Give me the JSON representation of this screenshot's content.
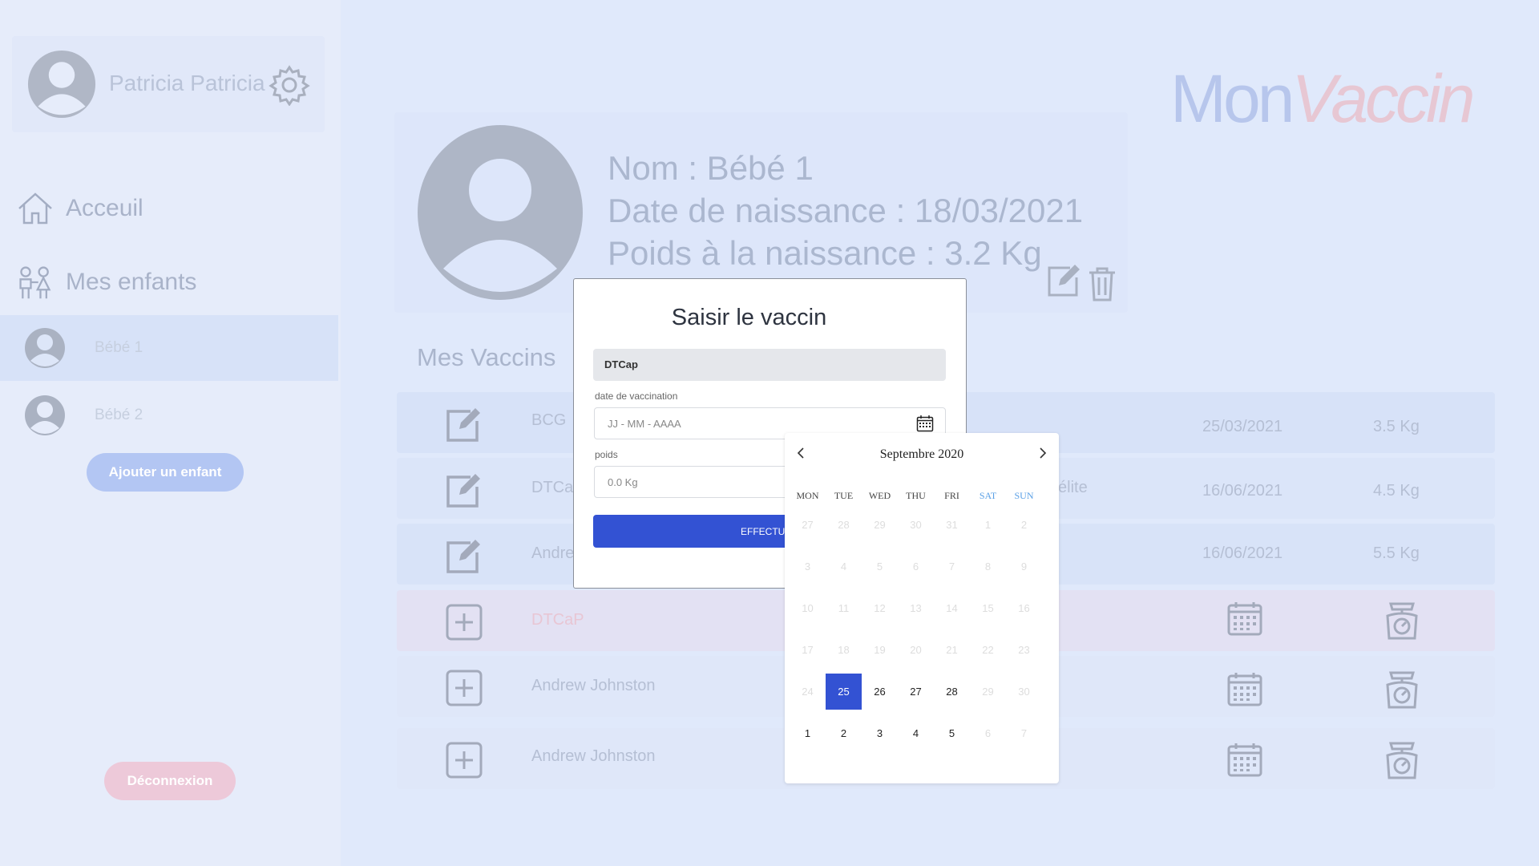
{
  "user": {
    "name": "Patricia Patricia"
  },
  "nav": {
    "home": "Acceuil",
    "children": "Mes enfants"
  },
  "children": [
    {
      "name": "Bébé 1"
    },
    {
      "name": "Bébé 2"
    }
  ],
  "buttons": {
    "add_child": "Ajouter un enfant",
    "logout": "Déconnexion"
  },
  "logo": {
    "part1": "Mon",
    "part2": "Vaccin"
  },
  "profile": {
    "name_line": "Nom : Bébé 1",
    "birth_line": "Date de naissance : 18/03/2021",
    "weight_line": "Poids à la naissance : 3.2 Kg"
  },
  "vaccines": {
    "title": "Mes Vaccins",
    "rows": [
      {
        "name": "BCG",
        "extra": "",
        "date": "25/03/2021",
        "weight": "3.5 Kg",
        "done": true
      },
      {
        "name": "DTCaP",
        "extra": "élite",
        "date": "16/06/2021",
        "weight": "4.5 Kg",
        "done": true
      },
      {
        "name": "Andre",
        "extra": "",
        "date": "16/06/2021",
        "weight": "5.5 Kg",
        "done": true
      },
      {
        "name": "DTCaP",
        "extra": "",
        "date": "",
        "weight": "",
        "done": false
      },
      {
        "name": "Andrew Johnston",
        "extra": "",
        "date": "",
        "weight": "",
        "done": false
      },
      {
        "name": "Andrew Johnston",
        "extra": "",
        "date": "",
        "weight": "",
        "done": false
      }
    ]
  },
  "modal": {
    "title": "Saisir le vaccin",
    "vaccine_value": "DTCap",
    "date_label": "date de vaccination",
    "date_placeholder": "JJ - MM - AAAA",
    "weight_label": "poids",
    "weight_placeholder": "0.0 Kg",
    "submit_label": "EFFECTUER"
  },
  "datepicker": {
    "month_label": "Septembre 2020",
    "weekdays": [
      "MON",
      "TUE",
      "WED",
      "THU",
      "FRI",
      "SAT",
      "SUN"
    ],
    "weeks": [
      [
        "27",
        "28",
        "29",
        "30",
        "31",
        "1",
        "2"
      ],
      [
        "3",
        "4",
        "5",
        "6",
        "7",
        "8",
        "9"
      ],
      [
        "10",
        "11",
        "12",
        "13",
        "14",
        "15",
        "16"
      ],
      [
        "17",
        "18",
        "19",
        "20",
        "21",
        "22",
        "23"
      ],
      [
        "24",
        "25",
        "26",
        "27",
        "28",
        "29",
        "30"
      ],
      [
        "1",
        "2",
        "3",
        "4",
        "5",
        "6",
        "7"
      ]
    ],
    "selected_day": "25"
  },
  "colors": {
    "primary": "#3352d3",
    "accent_pink": "#e9c7d4",
    "weekend": "#5aa0e6"
  }
}
